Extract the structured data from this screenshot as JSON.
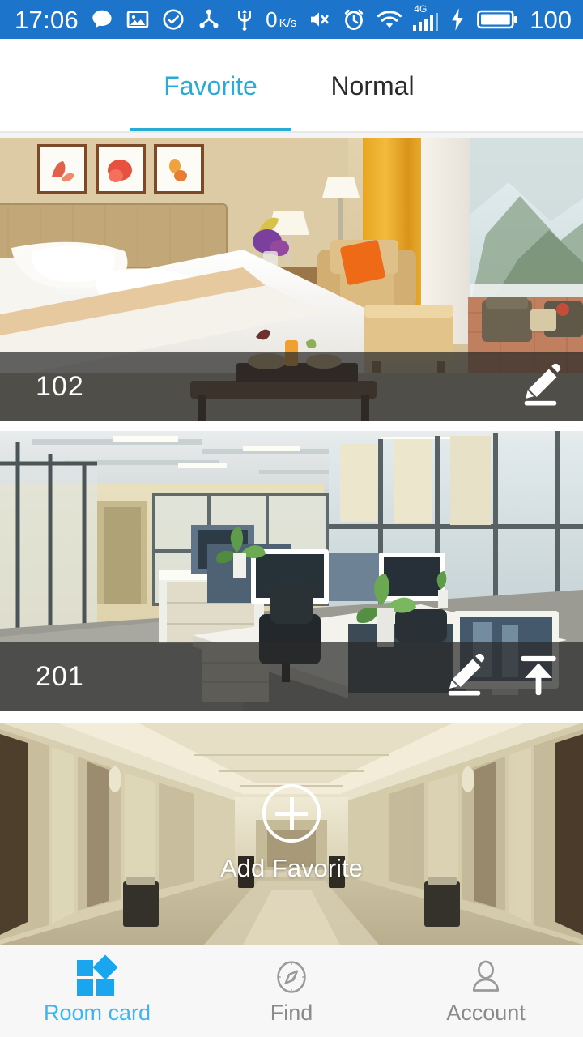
{
  "statusbar": {
    "time": "17:06",
    "net_speed_value": "0",
    "net_speed_unit_top": "K",
    "net_speed_unit_bottom": "s",
    "signal_label": "4G",
    "battery_percent": "100",
    "icons": [
      "message-icon",
      "gallery-icon",
      "check-circle-icon",
      "share-icon",
      "usb-icon",
      "mute-icon",
      "alarm-icon",
      "wifi-icon",
      "signal-icon",
      "charging-icon",
      "battery-icon"
    ]
  },
  "tabs": [
    {
      "label": "Favorite",
      "active": true
    },
    {
      "label": "Normal",
      "active": false
    }
  ],
  "cards": [
    {
      "label": "102",
      "photo": "hotel-room-photo",
      "actions": [
        "edit-icon"
      ]
    },
    {
      "label": "201",
      "photo": "office-photo",
      "actions": [
        "edit-icon",
        "upload-icon"
      ]
    }
  ],
  "add_favorite": {
    "label": "Add Favorite",
    "photo": "lobby-corridor-photo",
    "icon": "plus-circle-icon"
  },
  "bottom_nav": [
    {
      "label": "Room card",
      "icon": "room-card-icon",
      "active": true
    },
    {
      "label": "Find",
      "icon": "compass-icon",
      "active": false
    },
    {
      "label": "Account",
      "icon": "person-icon",
      "active": false
    }
  ],
  "colors": {
    "status_bar": "#1c74cb",
    "accent_tab": "#29abd5",
    "accent_nav": "#19a6ef",
    "overlay": "rgba(42,42,42,0.72)"
  }
}
